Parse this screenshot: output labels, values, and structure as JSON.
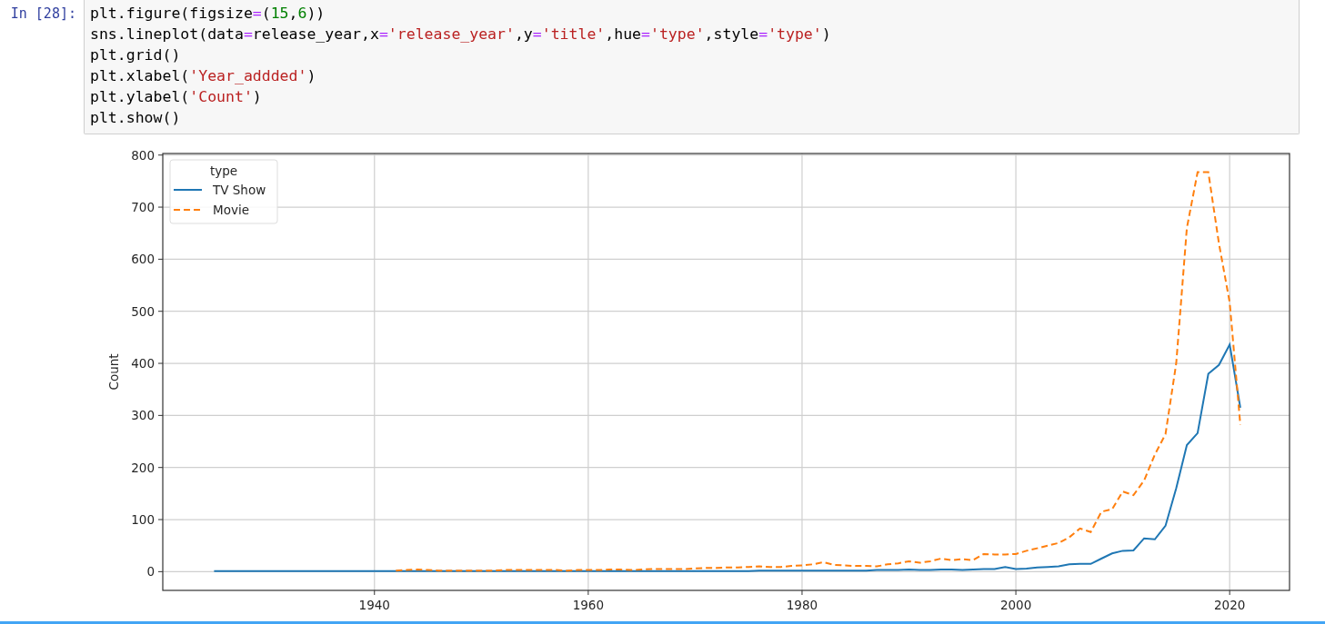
{
  "cell": {
    "prompt": "In [28]:",
    "code_lines": [
      [
        {
          "text": "plt.figure(figsize",
          "kind": "plain"
        },
        {
          "text": "=",
          "kind": "op"
        },
        {
          "text": "(",
          "kind": "plain"
        },
        {
          "text": "15",
          "kind": "num"
        },
        {
          "text": ",",
          "kind": "plain"
        },
        {
          "text": "6",
          "kind": "num"
        },
        {
          "text": "))",
          "kind": "plain"
        }
      ],
      [
        {
          "text": "sns.lineplot(data",
          "kind": "plain"
        },
        {
          "text": "=",
          "kind": "op"
        },
        {
          "text": "release_year,x",
          "kind": "plain"
        },
        {
          "text": "=",
          "kind": "op"
        },
        {
          "text": "'release_year'",
          "kind": "str"
        },
        {
          "text": ",y",
          "kind": "plain"
        },
        {
          "text": "=",
          "kind": "op"
        },
        {
          "text": "'title'",
          "kind": "str"
        },
        {
          "text": ",hue",
          "kind": "plain"
        },
        {
          "text": "=",
          "kind": "op"
        },
        {
          "text": "'type'",
          "kind": "str"
        },
        {
          "text": ",style",
          "kind": "plain"
        },
        {
          "text": "=",
          "kind": "op"
        },
        {
          "text": "'type'",
          "kind": "str"
        },
        {
          "text": ")",
          "kind": "plain"
        }
      ],
      [
        {
          "text": "plt.grid()",
          "kind": "plain"
        }
      ],
      [
        {
          "text": "plt.xlabel(",
          "kind": "plain"
        },
        {
          "text": "'Year_addded'",
          "kind": "str"
        },
        {
          "text": ")",
          "kind": "plain"
        }
      ],
      [
        {
          "text": "plt.ylabel(",
          "kind": "plain"
        },
        {
          "text": "'Count'",
          "kind": "str"
        },
        {
          "text": ")",
          "kind": "plain"
        }
      ],
      [
        {
          "text": "plt.show()",
          "kind": "plain"
        }
      ]
    ]
  },
  "output": {
    "chart_data": {
      "type": "line",
      "ylabel": "Count",
      "grid": true,
      "legend": {
        "title": "type"
      },
      "x": [
        1925,
        1926,
        1927,
        1928,
        1929,
        1930,
        1931,
        1932,
        1933,
        1934,
        1935,
        1936,
        1937,
        1938,
        1939,
        1940,
        1941,
        1942,
        1943,
        1944,
        1945,
        1946,
        1947,
        1948,
        1949,
        1950,
        1951,
        1952,
        1953,
        1954,
        1955,
        1956,
        1957,
        1958,
        1959,
        1960,
        1961,
        1962,
        1963,
        1964,
        1965,
        1966,
        1967,
        1968,
        1969,
        1970,
        1971,
        1972,
        1973,
        1974,
        1975,
        1976,
        1977,
        1978,
        1979,
        1980,
        1981,
        1982,
        1983,
        1984,
        1985,
        1986,
        1987,
        1988,
        1989,
        1990,
        1991,
        1992,
        1993,
        1994,
        1995,
        1996,
        1997,
        1998,
        1999,
        2000,
        2001,
        2002,
        2003,
        2004,
        2005,
        2006,
        2007,
        2008,
        2009,
        2010,
        2011,
        2012,
        2013,
        2014,
        2015,
        2016,
        2017,
        2018,
        2019,
        2020,
        2021
      ],
      "series": [
        {
          "name": "TV Show",
          "color": "#1f77b4",
          "line_style": "solid",
          "values": [
            1,
            1,
            1,
            1,
            1,
            1,
            1,
            1,
            1,
            1,
            1,
            1,
            1,
            1,
            1,
            1,
            1,
            1,
            1,
            1,
            1,
            1,
            1,
            1,
            1,
            1,
            1,
            1,
            1,
            1,
            1,
            1,
            1,
            1,
            1,
            1,
            1,
            1,
            1,
            1,
            1,
            1,
            1,
            1,
            1,
            1,
            1,
            1,
            1,
            1,
            1,
            2,
            2,
            2,
            2,
            2,
            2,
            2,
            2,
            2,
            2,
            2,
            3,
            3,
            3,
            4,
            3,
            3,
            4,
            4,
            3,
            4,
            5,
            5,
            9,
            5,
            6,
            8,
            9,
            10,
            14,
            15,
            15,
            25,
            35,
            40,
            41,
            64,
            62,
            88,
            160,
            243,
            266,
            380,
            397,
            436,
            315
          ]
        },
        {
          "name": "Movie",
          "color": "#ff7f0e",
          "line_style": "dashed",
          "values": [
            null,
            null,
            null,
            null,
            null,
            null,
            null,
            null,
            null,
            null,
            null,
            null,
            null,
            null,
            null,
            null,
            null,
            2,
            3,
            4,
            3,
            2,
            2,
            2,
            2,
            2,
            2,
            3,
            3,
            3,
            3,
            3,
            3,
            2,
            3,
            3,
            3,
            4,
            4,
            3,
            4,
            5,
            5,
            5,
            5,
            6,
            7,
            7,
            8,
            8,
            9,
            10,
            9,
            9,
            11,
            12,
            14,
            18,
            13,
            12,
            11,
            11,
            10,
            14,
            16,
            20,
            17,
            20,
            25,
            22,
            24,
            22,
            34,
            33,
            33,
            34,
            40,
            45,
            50,
            55,
            66,
            83,
            76,
            115,
            120,
            154,
            147,
            175,
            225,
            264,
            400,
            660,
            767,
            767,
            630,
            517,
            282
          ]
        }
      ],
      "xlim": [
        1920.2,
        2025.6
      ],
      "ylim": [
        -36,
        803
      ],
      "xticks": [
        1940,
        1960,
        1980,
        2000,
        2020
      ],
      "yticks": [
        0,
        100,
        200,
        300,
        400,
        500,
        600,
        700,
        800
      ]
    }
  }
}
